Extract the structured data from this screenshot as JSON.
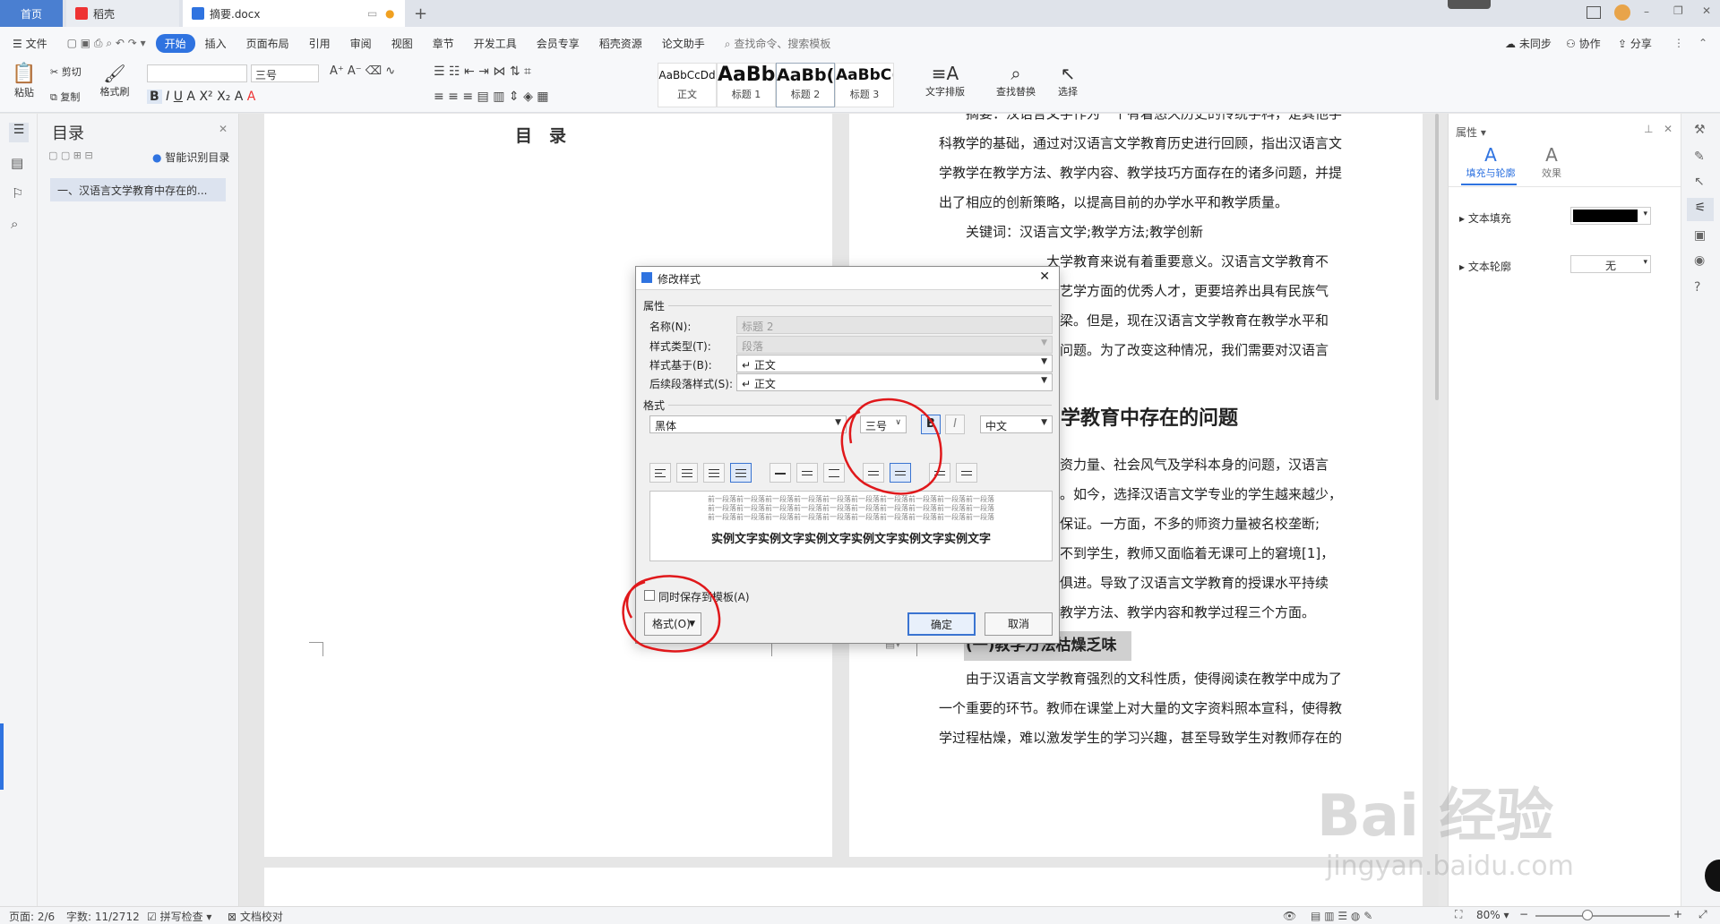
{
  "tabs": {
    "home": "首页",
    "daoke": "稻壳",
    "doc": "摘要.docx"
  },
  "menu": {
    "file": "文件",
    "items": [
      "开始",
      "插入",
      "页面布局",
      "引用",
      "审阅",
      "视图",
      "章节",
      "开发工具",
      "会员专享",
      "稻壳资源",
      "论文助手"
    ],
    "search_placeholder": "查找命令、搜索模板",
    "unsynced": "未同步",
    "collab": "协作",
    "share": "分享"
  },
  "ribbon": {
    "paste": "粘贴",
    "cut": "剪切",
    "copy": "复制",
    "format_painter": "格式刷",
    "font_size": "三号",
    "styles": [
      {
        "preview": "AaBbCcDd",
        "label": "正文"
      },
      {
        "preview": "AaBb",
        "label": "标题 1"
      },
      {
        "preview": "AaBb(",
        "label": "标题 2"
      },
      {
        "preview": "AaBbC(",
        "label": "标题 3"
      }
    ],
    "text_layout": "文字排版",
    "find_replace": "查找替换",
    "select": "选择"
  },
  "toc": {
    "title": "目录",
    "smart": "智能识别目录",
    "item": "一、汉语言文学教育中存在的..."
  },
  "doc": {
    "toc_heading": "目　录",
    "lines": [
      "摘要：汉语言文学作为一个有着悠久历史的传统学科，是其他学",
      "科教学的基础，通过对汉语言文学教育历史进行回顾，指出汉语言文",
      "学教学在教学方法、教学内容、教学技巧方面存在的诸多问题，并提",
      "出了相应的创新策略，以提高目前的办学水平和教学质量。",
      "关键词：汉语言文学;教学方法;教学创新",
      "大学教育来说有着重要意义。汉语言文学教育不",
      "文艺学方面的优秀人才，更要培养出具有民族气",
      "栋梁。但是，现在汉语言文学教育在教学水平和",
      "多问题。为了改变这种情况，我们需要对汉语言"
    ],
    "heading2": "学教育中存在的问题",
    "lines2": [
      "师资力量、社会风气及学科本身的问题，汉语言",
      "观。如今，选择汉语言文学专业的学生越来越少，",
      "到保证。一方面，不多的师资力量被名校垄断;",
      "招不到学生，教师又面临着无课可上的窘境[1]，",
      "时俱进。导致了汉语言文学教育的授课水平持续",
      "下降，其表现主要有教学方法、教学内容和教学过程三个方面。"
    ],
    "heading3": "(一)教学方法枯燥乏味",
    "lines3": [
      "由于汉语言文学教育强烈的文科性质，使得阅读在教学中成为了",
      "一个重要的环节。教师在课堂上对大量的文字资料照本宣科，使得教",
      "学过程枯燥，难以激发学生的学习兴趣，甚至导致学生对教师存在的"
    ]
  },
  "right_panel": {
    "title": "属性",
    "tab_fill": "填充与轮廓",
    "tab_effect": "效果",
    "text_fill": "文本填充",
    "text_outline": "文本轮廓",
    "outline_value": "无"
  },
  "dialog": {
    "title": "修改样式",
    "section_props": "属性",
    "name_label": "名称(N):",
    "name_value": "标题 2",
    "type_label": "样式类型(T):",
    "type_value": "段落",
    "based_label": "样式基于(B):",
    "based_value": "↵ 正文",
    "next_label": "后续段落样式(S):",
    "next_value": "↵ 正文",
    "section_format": "格式",
    "font": "黑体",
    "size": "三号",
    "bold": "B",
    "italic": "I",
    "lang": "中文",
    "preview_prev": "前一段落前一段落前一段落前一段落前一段落前一段落前一段落前一段落前一段落前一段落",
    "preview_sample": "实例文字实例文字实例文字实例文字实例文字实例文字",
    "save_template": "同时保存到模板(A)",
    "format_btn": "格式(O)",
    "ok": "确定",
    "cancel": "取消"
  },
  "status": {
    "page": "页面: 2/6",
    "words": "字数: 11/2712",
    "spell": "拼写检查",
    "proof": "文档校对",
    "zoom": "80%"
  },
  "watermark": {
    "brand": "Bai 经验",
    "url": "jingyan.baidu.com"
  },
  "colors": {
    "accent": "#2f73e0",
    "annotation": "#e0181b"
  }
}
